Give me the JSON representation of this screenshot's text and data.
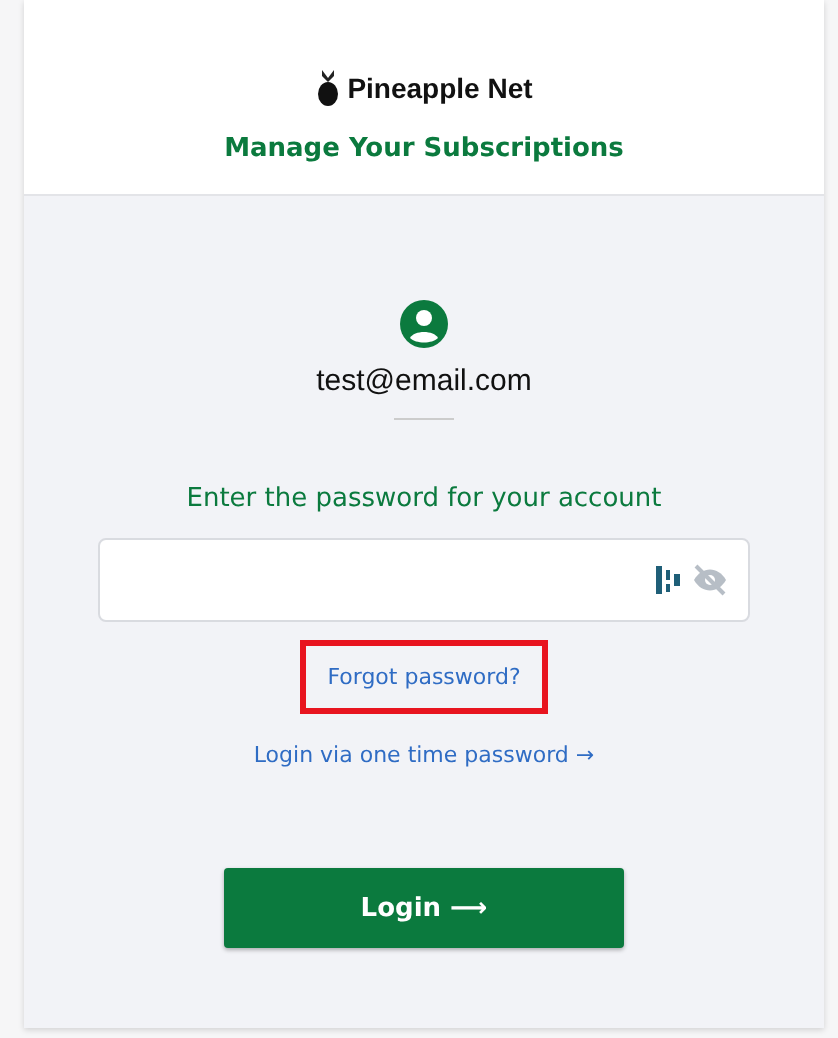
{
  "header": {
    "brand": "Pineapple Net",
    "title": "Manage Your Subscriptions"
  },
  "account": {
    "email": "test@email.com"
  },
  "prompt": "Enter the password for your account",
  "password_field": {
    "password_visible": false
  },
  "links": [
    {
      "label": "Forgot password?",
      "highlighted": true
    },
    {
      "label": "Login via one time password →",
      "highlighted": false
    }
  ],
  "login_button": {
    "label": "Login ⟶"
  }
}
